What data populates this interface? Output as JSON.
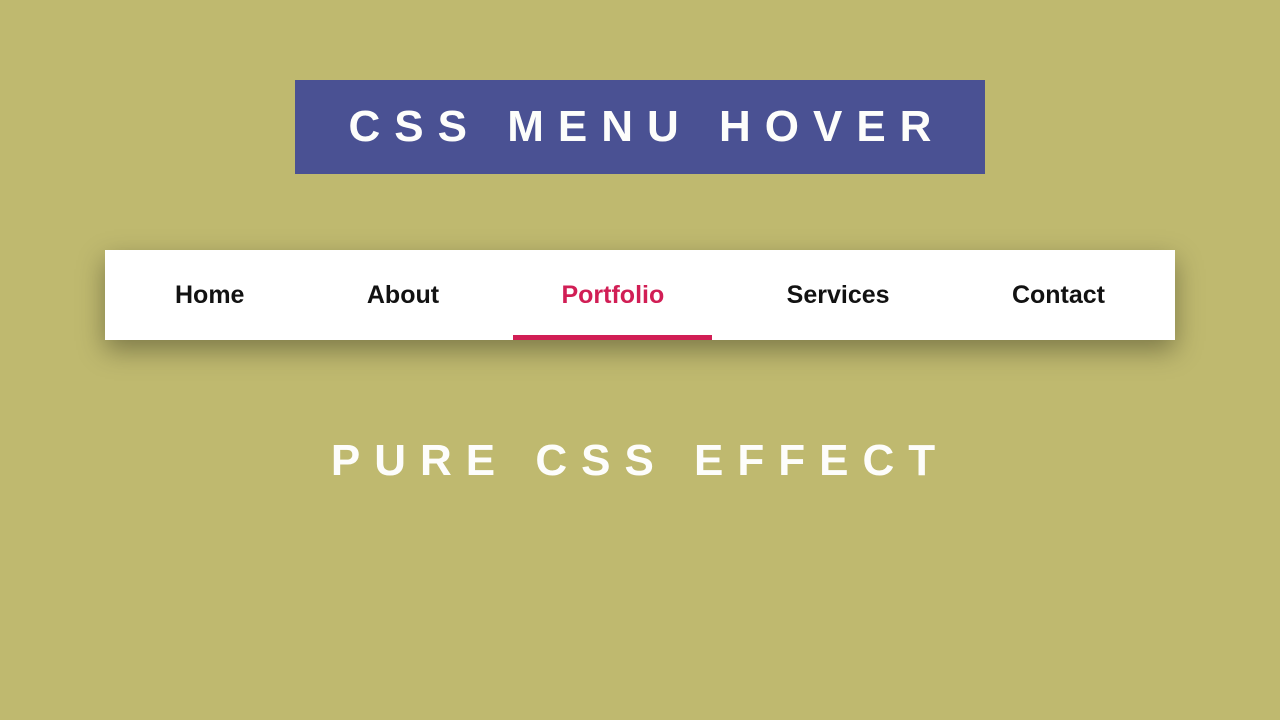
{
  "title": "CSS MENU HOVER",
  "subtitle": "PURE CSS EFFECT",
  "nav": {
    "items": [
      {
        "label": "Home",
        "active": false
      },
      {
        "label": "About",
        "active": false
      },
      {
        "label": "Portfolio",
        "active": true
      },
      {
        "label": "Services",
        "active": false
      },
      {
        "label": "Contact",
        "active": false
      }
    ]
  },
  "colors": {
    "background": "#bfb96f",
    "banner": "#4a5193",
    "accent": "#d11e55",
    "text_light": "#fdfdfb",
    "text_dark": "#121212",
    "navbar_bg": "#ffffff"
  }
}
